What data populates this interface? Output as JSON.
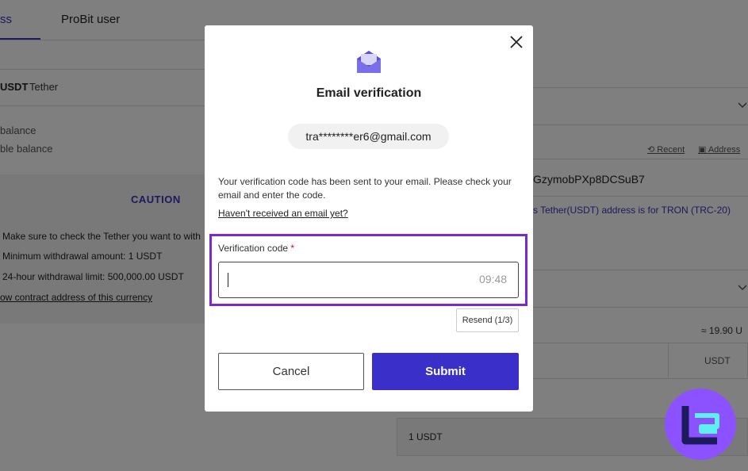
{
  "background": {
    "tabs": {
      "active_partial": "ss",
      "probit_user": "ProBit user"
    },
    "coin": {
      "symbol": "USDT",
      "name": "Tether"
    },
    "balance": {
      "line1": "balance",
      "line2": "ble balance"
    },
    "caution": {
      "title": "CAUTION",
      "lines": [
        "Make sure to check the Tether you want to with",
        "Minimum withdrawal amount: 1 USDT",
        "24-hour withdrawal limit: 500,000.00 USDT"
      ],
      "link": "ow contract address of this currency"
    },
    "right": {
      "recent": "Recent",
      "address_book": "Address",
      "address_value": "GzymobPXp8DCSuB7",
      "notice": "s Tether(USDT) address is for TRON (TRC-20)",
      "approx": "≈ 19.90 U",
      "unit": "USDT",
      "min_value": "1 USDT"
    }
  },
  "modal": {
    "title": "Email verification",
    "email": "tra********er6@gmail.com",
    "message": "Your verification code has been sent to your email. Please check your email and enter the code.",
    "not_received": "Haven't received an email yet?",
    "code_label": "Verification code",
    "required_mark": "*",
    "code_value": "",
    "timer": "09:48",
    "resend": "Resend (1/3)",
    "cancel": "Cancel",
    "submit": "Submit"
  },
  "colors": {
    "accent": "#3b2fc9",
    "highlight": "#7b28d4",
    "logo_bg": "#8c52ff"
  },
  "icons": [
    "mail-open-icon",
    "close-icon",
    "history-icon",
    "address-book-icon",
    "chevron-down-icon"
  ]
}
